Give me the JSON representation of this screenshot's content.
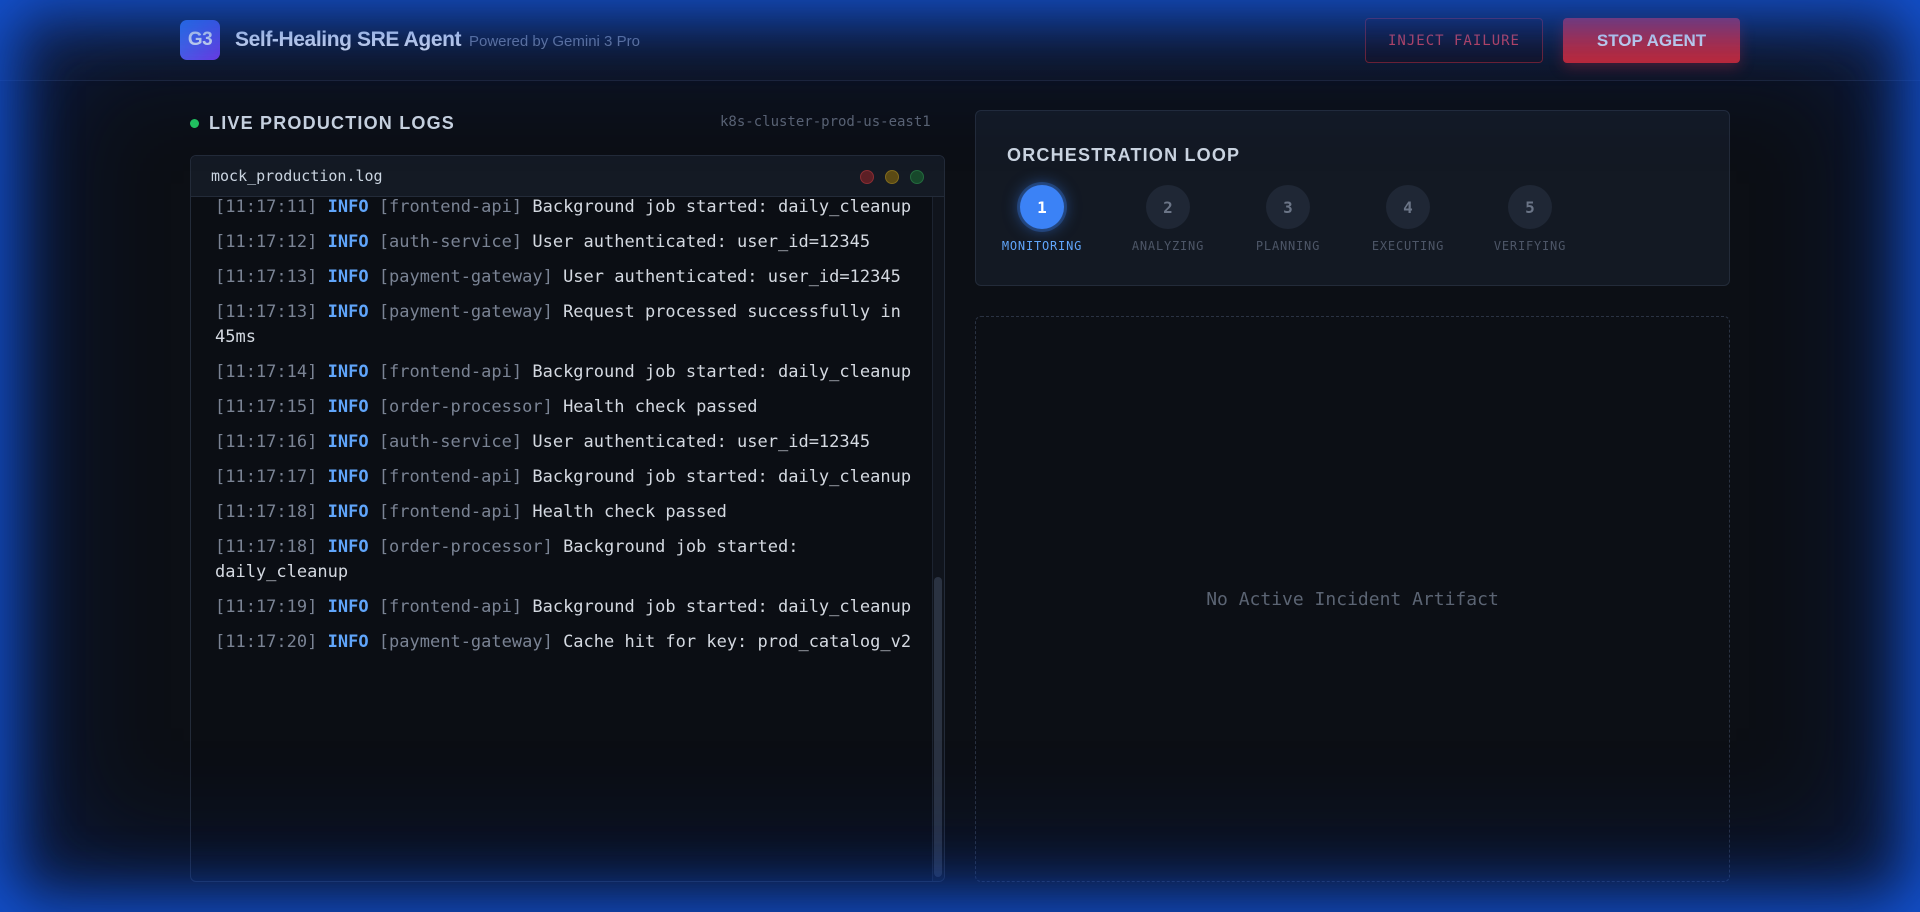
{
  "header": {
    "logo_text": "G3",
    "title": "Self-Healing SRE Agent",
    "subtitle": "Powered by Gemini 3 Pro",
    "inject_label": "INJECT FAILURE",
    "stop_label": "STOP AGENT"
  },
  "logs_panel": {
    "title": "LIVE PRODUCTION LOGS",
    "cluster": "k8s-cluster-prod-us-east1",
    "filename": "mock_production.log",
    "entries": [
      {
        "ts": "[11:17:11]",
        "level": "INFO",
        "service": "[frontend-api]",
        "message": "Background job started: daily_cleanup"
      },
      {
        "ts": "[11:17:12]",
        "level": "INFO",
        "service": "[auth-service]",
        "message": "User authenticated: user_id=12345"
      },
      {
        "ts": "[11:17:13]",
        "level": "INFO",
        "service": "[payment-gateway]",
        "message": "User authenticated: user_id=12345"
      },
      {
        "ts": "[11:17:13]",
        "level": "INFO",
        "service": "[payment-gateway]",
        "message": "Request processed successfully in 45ms"
      },
      {
        "ts": "[11:17:14]",
        "level": "INFO",
        "service": "[frontend-api]",
        "message": "Background job started: daily_cleanup"
      },
      {
        "ts": "[11:17:15]",
        "level": "INFO",
        "service": "[order-processor]",
        "message": "Health check passed"
      },
      {
        "ts": "[11:17:16]",
        "level": "INFO",
        "service": "[auth-service]",
        "message": "User authenticated: user_id=12345"
      },
      {
        "ts": "[11:17:17]",
        "level": "INFO",
        "service": "[frontend-api]",
        "message": "Background job started: daily_cleanup"
      },
      {
        "ts": "[11:17:18]",
        "level": "INFO",
        "service": "[frontend-api]",
        "message": "Health check passed"
      },
      {
        "ts": "[11:17:18]",
        "level": "INFO",
        "service": "[order-processor]",
        "message": "Background job started: daily_cleanup"
      },
      {
        "ts": "[11:17:19]",
        "level": "INFO",
        "service": "[frontend-api]",
        "message": "Background job started: daily_cleanup"
      },
      {
        "ts": "[11:17:20]",
        "level": "INFO",
        "service": "[payment-gateway]",
        "message": "Cache hit for key: prod_catalog_v2"
      }
    ]
  },
  "orchestration": {
    "title": "ORCHESTRATION LOOP",
    "active_step": 1,
    "steps": [
      {
        "number": "1",
        "label": "MONITORING"
      },
      {
        "number": "2",
        "label": "ANALYZING"
      },
      {
        "number": "3",
        "label": "PLANNING"
      },
      {
        "number": "4",
        "label": "EXECUTING"
      },
      {
        "number": "5",
        "label": "VERIFYING"
      }
    ]
  },
  "artifact": {
    "empty_text": "No Active Incident Artifact"
  },
  "colors": {
    "accent": "#3b82f6",
    "danger": "#dc2626",
    "live": "#22c55e",
    "glow": "#1d4ed8"
  }
}
